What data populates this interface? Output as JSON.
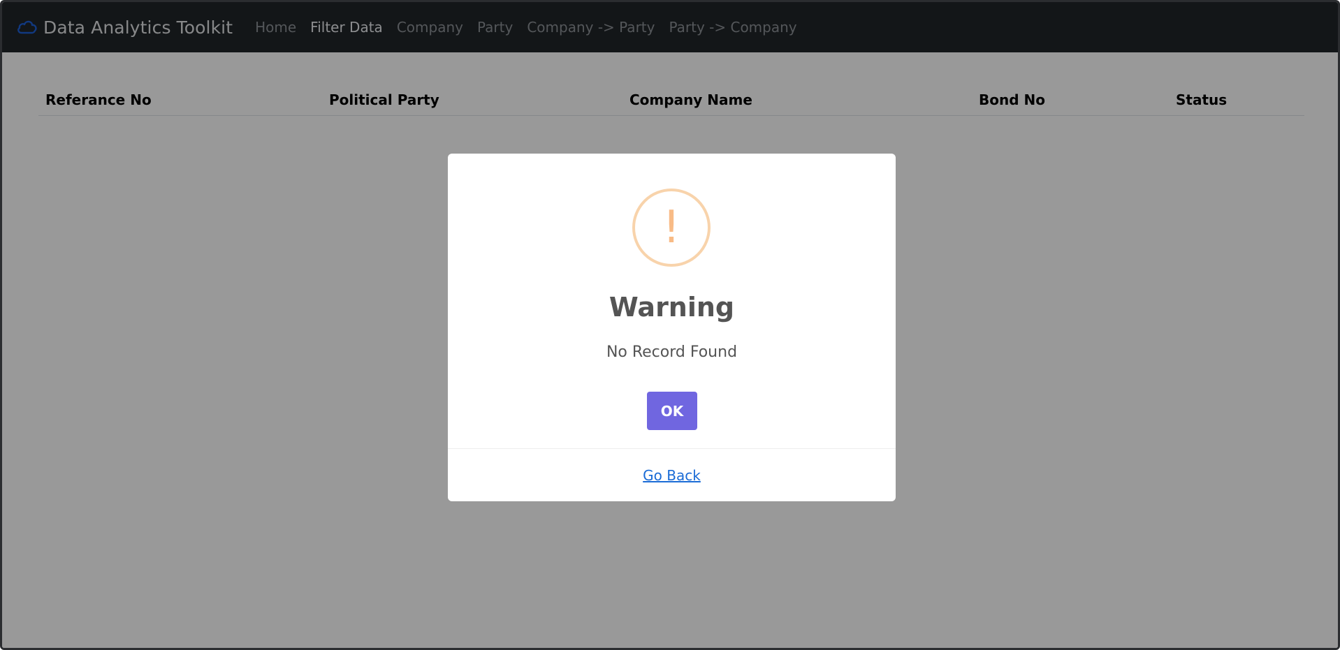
{
  "navbar": {
    "brand": "Data Analytics Toolkit",
    "brand_icon": "cloud-icon",
    "links": [
      {
        "label": "Home"
      },
      {
        "label": "Filter Data",
        "active": true
      },
      {
        "label": "Company"
      },
      {
        "label": "Party"
      },
      {
        "label": "Company -> Party"
      },
      {
        "label": "Party -> Company"
      }
    ]
  },
  "table": {
    "headers": [
      "Referance No",
      "Political Party",
      "Company Name",
      "Bond No",
      "Status"
    ]
  },
  "modal": {
    "icon": "warning-icon",
    "icon_glyph": "!",
    "title": "Warning",
    "text": "No Record Found",
    "ok_label": "OK",
    "footer_link": "Go Back"
  },
  "colors": {
    "navbar_bg": "#212529",
    "brand_icon": "#1d5fd6",
    "confirm_button": "#7066e0",
    "warning_ring": "#f8d3ab",
    "warning_glyph": "#f8bb86",
    "link": "#1a6bd6"
  }
}
